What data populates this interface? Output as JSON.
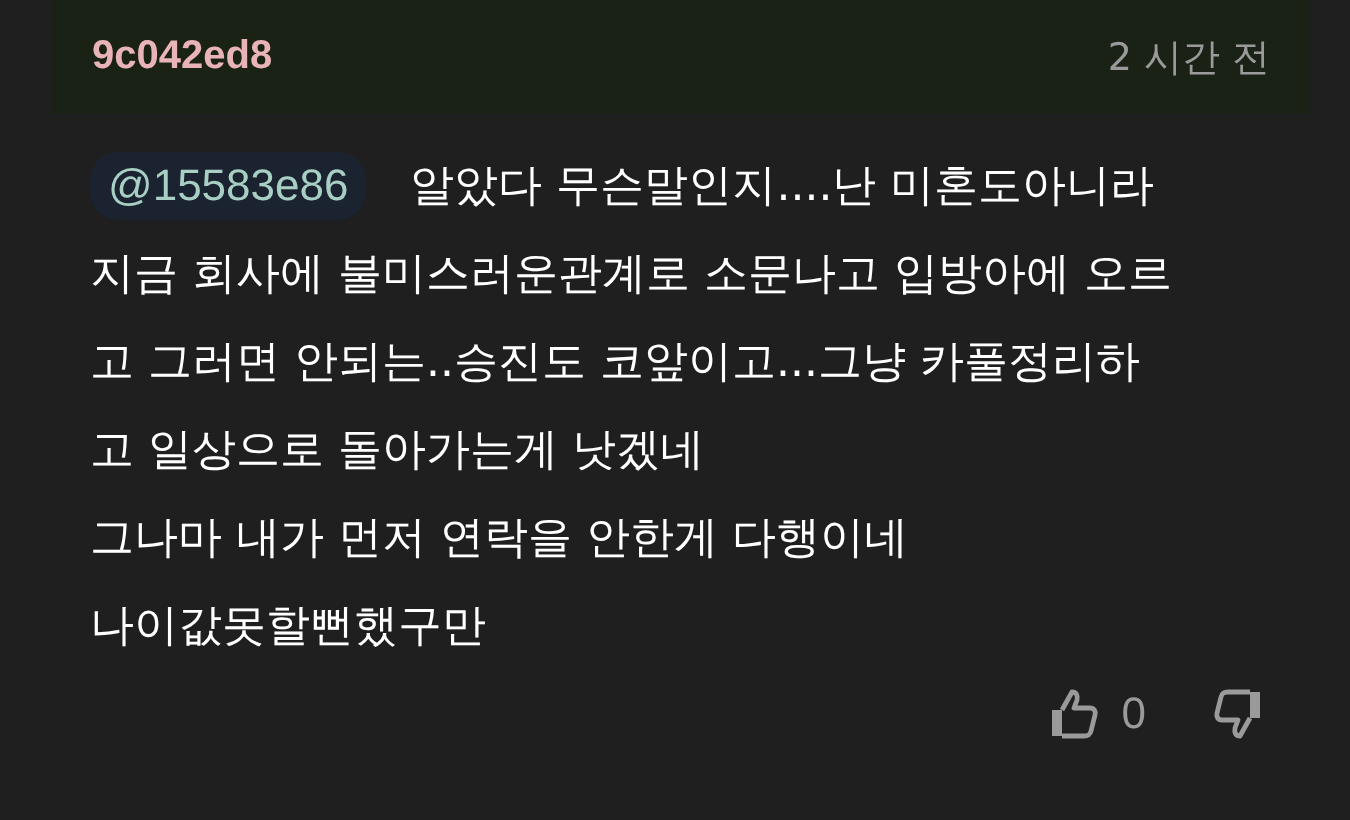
{
  "comment": {
    "author": "9c042ed8",
    "time": "2 시간 전",
    "mention": "@15583e86",
    "lines": [
      "알았다 무슨말인지....난 미혼도아니라",
      "지금 회사에 불미스러운관계로 소문나고 입방아에 오르",
      "고 그러면 안되는..승진도 코앞이고...그냥 카풀정리하",
      "고 일상으로 돌아가는게 낫겠네",
      "그나마 내가 먼저 연락을 안한게 다행이네",
      "나이값못할뻔했구만"
    ],
    "likes": "0"
  }
}
